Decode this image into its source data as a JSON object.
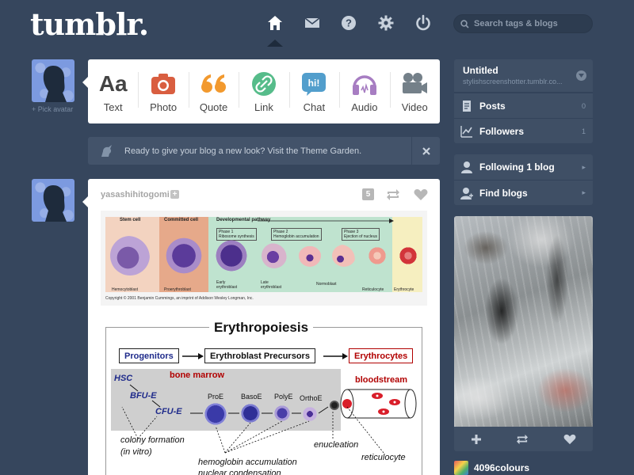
{
  "header": {
    "logo": "tumblr.",
    "search_placeholder": "Search tags & blogs",
    "nav_icons": [
      "home-icon",
      "mail-icon",
      "help-icon",
      "settings-icon",
      "power-icon"
    ]
  },
  "left": {
    "pick_avatar": "+ Pick avatar"
  },
  "post_types": [
    {
      "label": "Text",
      "icon": "text-icon",
      "color": "#444444"
    },
    {
      "label": "Photo",
      "icon": "camera-icon",
      "color": "#d95e40"
    },
    {
      "label": "Quote",
      "icon": "quote-icon",
      "color": "#f2992e"
    },
    {
      "label": "Link",
      "icon": "link-icon",
      "color": "#56bc8a"
    },
    {
      "label": "Chat",
      "icon": "chat-icon",
      "color": "#529ecc"
    },
    {
      "label": "Audio",
      "icon": "headphones-icon",
      "color": "#a77dc2"
    },
    {
      "label": "Video",
      "icon": "video-camera-icon",
      "color": "#748089"
    }
  ],
  "notice": {
    "text": "Ready to give your blog a new look? Visit the Theme Garden."
  },
  "post": {
    "author": "yasashihitogomi",
    "notes": "5",
    "figure1": {
      "headers": {
        "stem": "Stem cell",
        "committed": "Committed cell",
        "pathway": "Developmental pathway"
      },
      "phases": [
        "Phase 1\nRibosome synthesis",
        "Phase 2\nHemoglobin accumulation",
        "Phase 3\nEjection of nucleus"
      ],
      "labels": {
        "hemocytoblast": "Hemocytoblast",
        "proerythroblast": "Proerythroblast",
        "early": "Early erythroblast",
        "late": "Late erythroblast",
        "normoblast": "Normoblast",
        "reticulocyte": "Reticulocyte",
        "erythrocyte": "Erythrocyte"
      },
      "copyright": "Copyright © 2001 Benjamin Cummings, an imprint of Addison Wesley Longman, Inc."
    },
    "figure2": {
      "title": "Erythropoiesis",
      "progenitors": "Progenitors",
      "precursors": "Erythroblast Precursors",
      "erythrocytes": "Erythrocytes",
      "bone_marrow": "bone marrow",
      "bloodstream": "bloodstream",
      "hsc": "HSC",
      "bfue": "BFU-E",
      "cfue": "CFU-E",
      "proe": "ProE",
      "basoe": "BasoE",
      "polye": "PolyE",
      "orthoe": "OrthoE",
      "colony": "colony formation",
      "invitro": "(in vitro)",
      "enucleation": "enucleation",
      "reticulocyte": "reticulocyte",
      "hemoglobin": "hemoglobin accumulation",
      "nuclear": "nuclear condensation"
    }
  },
  "sidebar": {
    "blog": {
      "title": "Untitled",
      "url": "stylishscreenshotter.tumblr.co..."
    },
    "stats": [
      {
        "label": "Posts",
        "count": "0",
        "icon": "posts-icon"
      },
      {
        "label": "Followers",
        "count": "1",
        "icon": "followers-icon"
      }
    ],
    "social": [
      {
        "label": "Following 1 blog",
        "icon": "person-icon"
      },
      {
        "label": "Find blogs",
        "icon": "add-person-icon"
      }
    ],
    "radar_user": "4096colours"
  },
  "colors": {
    "background": "#36465d",
    "sidebar": "#3f4f65"
  }
}
